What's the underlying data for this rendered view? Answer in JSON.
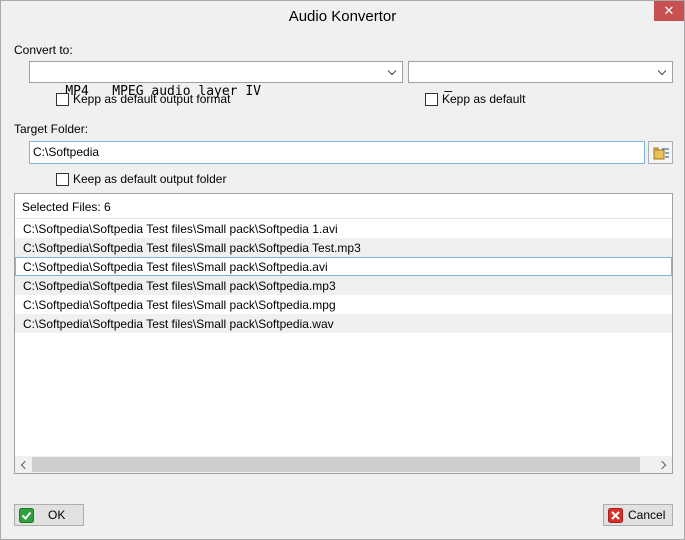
{
  "window": {
    "title": "Audio Konvertor",
    "close_glyph": "✕"
  },
  "convert": {
    "label": "Convert to:",
    "format_value": "MP4   MPEG audio layer IV",
    "option_value": "–",
    "default_format_checkbox": "Kepp as default output format",
    "default_option_checkbox": "Kepp as default"
  },
  "target": {
    "label": "Target Folder:",
    "folder_value": "C:\\Softpedia",
    "default_folder_checkbox": "Keep as default output folder"
  },
  "files": {
    "header": "Selected Files: 6",
    "items": [
      "C:\\Softpedia\\Softpedia Test files\\Small pack\\Softpedia 1.avi",
      "C:\\Softpedia\\Softpedia Test files\\Small pack\\Softpedia Test.mp3",
      "C:\\Softpedia\\Softpedia Test files\\Small pack\\Softpedia.avi",
      "C:\\Softpedia\\Softpedia Test files\\Small pack\\Softpedia.mp3",
      "C:\\Softpedia\\Softpedia Test files\\Small pack\\Softpedia.mpg",
      "C:\\Softpedia\\Softpedia Test files\\Small pack\\Softpedia.wav"
    ],
    "selected_index": 2
  },
  "buttons": {
    "ok": "OK",
    "cancel": "Cancel"
  },
  "icons": {
    "ok": "check-icon",
    "cancel": "x-icon",
    "browse": "folder-browse-icon"
  },
  "colors": {
    "close": "#c75050",
    "focus_border": "#7eb4ea",
    "ok_green": "#2e9e3e",
    "cancel_red": "#d9302c"
  }
}
